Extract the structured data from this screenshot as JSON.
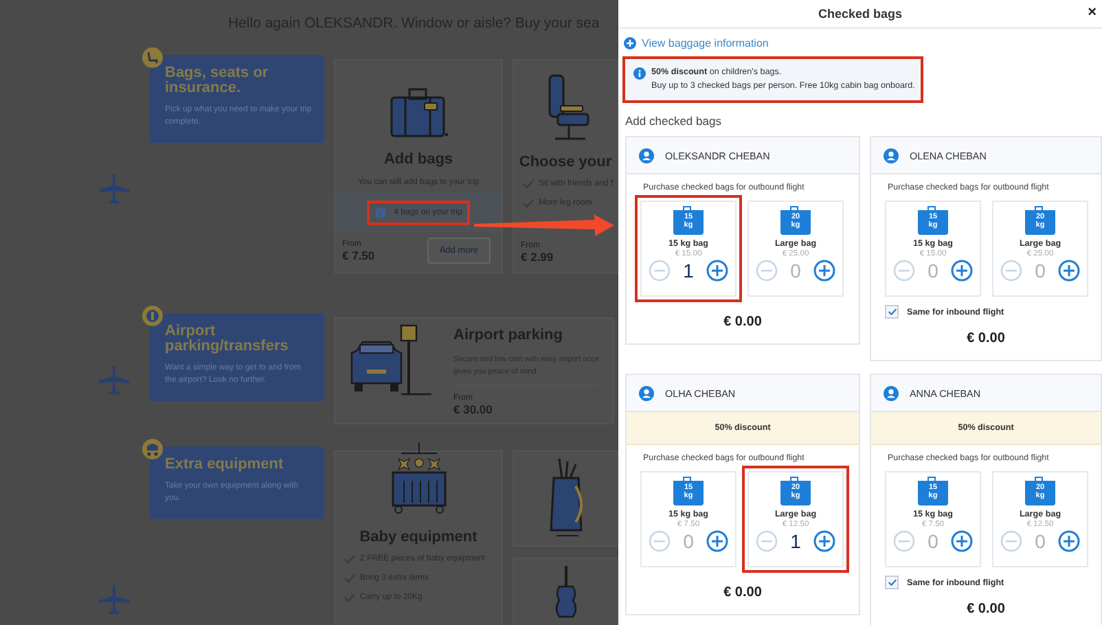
{
  "background_page": {
    "greeting": "Hello again OLEKSANDR. Window or aisle? Buy your sea",
    "sections": [
      {
        "kind": "seat",
        "title": "Bags, seats or insurance.",
        "description": "Pick up what you need to make your trip complete.",
        "columns": [
          [
            {
              "kind": "suitcase",
              "title": "Add bags",
              "subtitle": "You can still add bags to your trip",
              "notice": "4 bags on your trip",
              "notice_annotated": true,
              "price_label": "From",
              "price": "€ 7.50",
              "button": "Add more"
            }
          ],
          [
            {
              "kind": "seat",
              "title": "Choose your",
              "features": [
                "Sit with friends and f",
                "More leg room"
              ],
              "price_label": "From",
              "price": "€ 2.99"
            }
          ]
        ]
      },
      {
        "kind": "parking",
        "title": "Airport parking/transfers",
        "description": "Want a simple way to get to and from the airport? Look no further.",
        "columns": [
          [
            {
              "kind": "parking",
              "title": "Airport parking",
              "description_lines": [
                "Secure and low cost with easy airport acce",
                "gives you peace of mind"
              ],
              "price_label": "From",
              "price": "€ 30.00"
            }
          ]
        ]
      },
      {
        "kind": "stroller",
        "title": "Extra equipment",
        "description": "Take your own equipment along with you.",
        "columns": [
          [
            {
              "kind": "crib",
              "title": "Baby equipment",
              "features": [
                "2 FREE pieces of baby equipment",
                "Bring 3 extra items",
                "Carry up to 20Kg"
              ]
            }
          ],
          [
            {
              "kind": "golf"
            },
            {
              "kind": "violin"
            }
          ]
        ]
      }
    ]
  },
  "pointer_arrow": true,
  "dialog": {
    "title": "Checked bags",
    "close": "×",
    "link": "View baggage information",
    "notice": {
      "text": "**50% discount** on children's bags.",
      "text_2": "Buy up to 3 checked bags per person. Free 10kg cabin bag onboard.",
      "annotated": true
    },
    "section_title": "Add checked bags",
    "passengers": [
      {
        "name": "OLEKSANDR CHEBAN",
        "purchase_label": "Purchase checked bags for outbound flight",
        "total": "€ 0.00",
        "bags": [
          {
            "weight": "15",
            "unit": "kg",
            "name": "15 kg bag",
            "price": "€ 15.00",
            "count": "1",
            "active": true,
            "annotated": true
          },
          {
            "weight": "20",
            "unit": "kg",
            "name": "Large bag",
            "price": "€ 25.00",
            "count": "0",
            "active": false,
            "annotated": false
          }
        ]
      },
      {
        "name": "OLENA CHEBAN",
        "purchase_label": "Purchase checked bags for outbound flight",
        "total": "€ 0.00",
        "same_for_inbound": {
          "label": "Same for inbound flight",
          "checked": true
        },
        "bags": [
          {
            "weight": "15",
            "unit": "kg",
            "name": "15 kg bag",
            "price": "€ 15.00",
            "count": "0",
            "active": false,
            "annotated": false
          },
          {
            "weight": "20",
            "unit": "kg",
            "name": "Large bag",
            "price": "€ 25.00",
            "count": "0",
            "active": false,
            "annotated": false
          }
        ]
      },
      {
        "name": "OLHA CHEBAN",
        "discount": "50% discount",
        "purchase_label": "Purchase checked bags for outbound flight",
        "total": "€ 0.00",
        "bags": [
          {
            "weight": "15",
            "unit": "kg",
            "name": "15 kg bag",
            "price": "€ 7.50",
            "count": "0",
            "active": false,
            "annotated": false
          },
          {
            "weight": "20",
            "unit": "kg",
            "name": "Large bag",
            "price": "€ 12.50",
            "count": "1",
            "active": true,
            "annotated": true
          }
        ]
      },
      {
        "name": "ANNA CHEBAN",
        "discount": "50% discount",
        "purchase_label": "Purchase checked bags for outbound flight",
        "total": "€ 0.00",
        "same_for_inbound": {
          "label": "Same for inbound flight",
          "checked": true
        },
        "bags": [
          {
            "weight": "15",
            "unit": "kg",
            "name": "15 kg bag",
            "price": "€ 7.50",
            "count": "0",
            "active": false,
            "annotated": false
          },
          {
            "weight": "20",
            "unit": "kg",
            "name": "Large bag",
            "price": "€ 12.50",
            "count": "0",
            "active": false,
            "annotated": false
          }
        ]
      }
    ]
  }
}
